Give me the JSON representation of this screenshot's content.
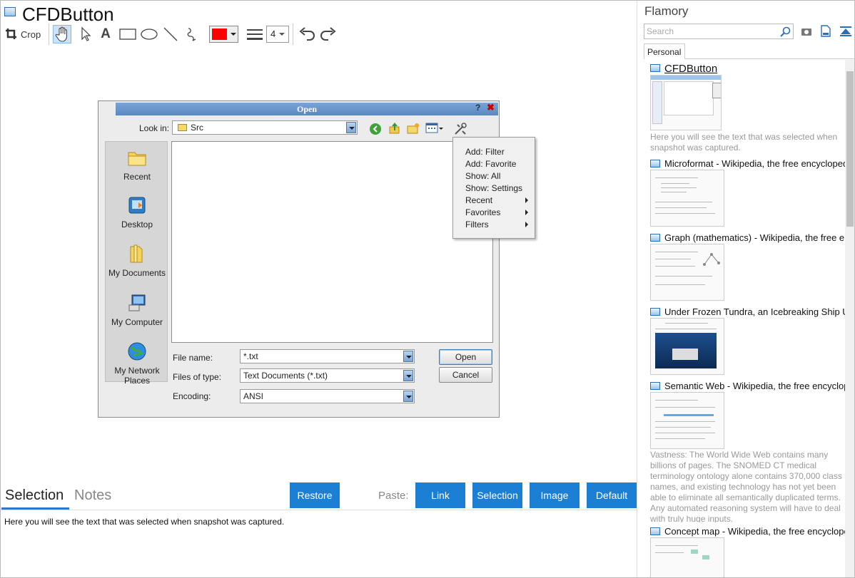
{
  "app": {
    "title": "CFDButton"
  },
  "toolbar": {
    "crop_label": "Crop",
    "text_tool_glyph": "A",
    "stroke_width": "4",
    "color": "#ff0000"
  },
  "dialog": {
    "title": "Open",
    "help_glyph": "?",
    "close_glyph": "✖",
    "look_in_label": "Look in:",
    "look_in_value": "Src",
    "places": [
      {
        "label": "Recent",
        "icon": "recent-folder-icon"
      },
      {
        "label": "Desktop",
        "icon": "desktop-icon"
      },
      {
        "label": "My Documents",
        "icon": "my-documents-icon"
      },
      {
        "label": "My Computer",
        "icon": "my-computer-icon"
      },
      {
        "label": "My Network Places",
        "icon": "network-icon"
      }
    ],
    "menu": [
      {
        "label": "Add: Filter",
        "submenu": false
      },
      {
        "label": "Add: Favorite",
        "submenu": false
      },
      {
        "label": "Show: All",
        "submenu": false
      },
      {
        "label": "Show: Settings",
        "submenu": false
      },
      {
        "label": "Recent",
        "submenu": true
      },
      {
        "label": "Favorites",
        "submenu": true
      },
      {
        "label": "Filters",
        "submenu": true
      }
    ],
    "file_name_label": "File name:",
    "file_name_value": "*.txt",
    "files_of_type_label": "Files of type:",
    "files_of_type_value": "Text Documents (*.txt)",
    "encoding_label": "Encoding:",
    "encoding_value": "ANSI",
    "open_button": "Open",
    "cancel_button": "Cancel"
  },
  "bottom": {
    "tab_selection": "Selection",
    "tab_notes": "Notes",
    "restore_button": "Restore",
    "paste_label": "Paste:",
    "paste_buttons": [
      "Link",
      "Selection",
      "Image",
      "Default"
    ],
    "selection_text": "Here you will see the text that was selected when snapshot was captured."
  },
  "sidebar": {
    "title": "Flamory",
    "search_placeholder": "Search",
    "tab_personal": "Personal",
    "entries": [
      {
        "title": "CFDButton",
        "desc": "Here you will see the text that was selected when snapshot was captured."
      },
      {
        "title": "Microformat - Wikipedia, the free encyclopedia",
        "desc": ""
      },
      {
        "title": "Graph (mathematics) - Wikipedia, the free ency",
        "desc": ""
      },
      {
        "title": "Under Frozen Tundra, an Icebreaking Ship Unco",
        "desc": ""
      },
      {
        "title": "Semantic Web - Wikipedia, the free encycloped",
        "desc": "Vastness: The World Wide Web contains many billions of pages. The SNOMED CT medical terminology ontology alone contains 370,000 class names, and existing technology has not yet been able to eliminate all semantically duplicated terms. Any automated reasoning system will have to deal with truly huge inputs."
      },
      {
        "title": "Concept map - Wikipedia, the free encyclopedi",
        "desc": ""
      }
    ]
  }
}
